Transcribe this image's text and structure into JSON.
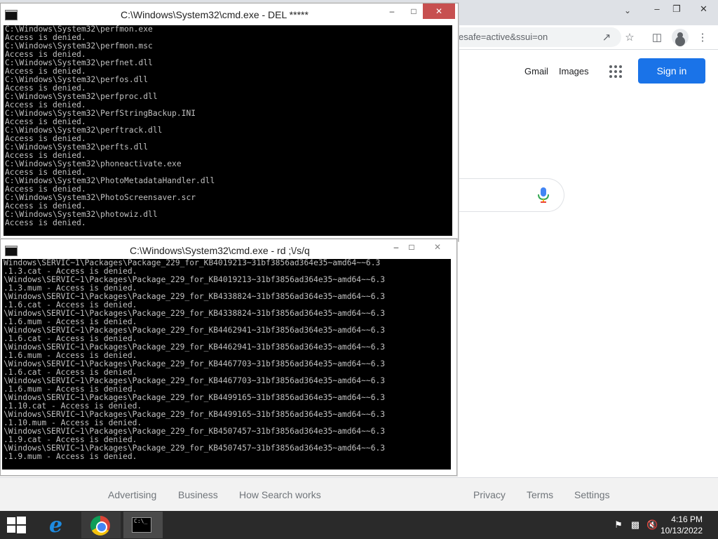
{
  "browser": {
    "omnibox_text": "esafe=active&ssui=on",
    "nav": {
      "gmail": "Gmail",
      "images": "Images"
    },
    "signin_label": "Sign in",
    "footer": {
      "advertising": "Advertising",
      "business": "Business",
      "how_search_works": "How Search works",
      "privacy": "Privacy",
      "terms": "Terms",
      "settings": "Settings"
    },
    "colors": {
      "signin_bg": "#1a73e8",
      "footer_bg": "#f2f2f2"
    }
  },
  "cmd_windows": [
    {
      "title": "C:\\Windows\\System32\\cmd.exe - DEL  *****",
      "lines": [
        "C:\\Windows\\System32\\perfmon.exe",
        "Access is denied.",
        "C:\\Windows\\System32\\perfmon.msc",
        "Access is denied.",
        "C:\\Windows\\System32\\perfnet.dll",
        "Access is denied.",
        "C:\\Windows\\System32\\perfos.dll",
        "Access is denied.",
        "C:\\Windows\\System32\\perfproc.dll",
        "Access is denied.",
        "C:\\Windows\\System32\\PerfStringBackup.INI",
        "Access is denied.",
        "C:\\Windows\\System32\\perftrack.dll",
        "Access is denied.",
        "C:\\Windows\\System32\\perfts.dll",
        "Access is denied.",
        "C:\\Windows\\System32\\phoneactivate.exe",
        "Access is denied.",
        "C:\\Windows\\System32\\PhotoMetadataHandler.dll",
        "Access is denied.",
        "C:\\Windows\\System32\\PhotoScreensaver.scr",
        "Access is denied.",
        "C:\\Windows\\System32\\photowiz.dll",
        "Access is denied."
      ]
    },
    {
      "title": "C:\\Windows\\System32\\cmd.exe - rd ;\\/s/q",
      "lines": [
        "Windows\\SERVIC~1\\Packages\\Package_229_for_KB4019213~31bf3856ad364e35~amd64~~6.3",
        ".1.3.cat - Access is denied.",
        "\\Windows\\SERVIC~1\\Packages\\Package_229_for_KB4019213~31bf3856ad364e35~amd64~~6.3",
        ".1.3.mum - Access is denied.",
        "\\Windows\\SERVIC~1\\Packages\\Package_229_for_KB4338824~31bf3856ad364e35~amd64~~6.3",
        ".1.6.cat - Access is denied.",
        "\\Windows\\SERVIC~1\\Packages\\Package_229_for_KB4338824~31bf3856ad364e35~amd64~~6.3",
        ".1.6.mum - Access is denied.",
        "\\Windows\\SERVIC~1\\Packages\\Package_229_for_KB4462941~31bf3856ad364e35~amd64~~6.3",
        ".1.6.cat - Access is denied.",
        "\\Windows\\SERVIC~1\\Packages\\Package_229_for_KB4462941~31bf3856ad364e35~amd64~~6.3",
        ".1.6.mum - Access is denied.",
        "\\Windows\\SERVIC~1\\Packages\\Package_229_for_KB4467703~31bf3856ad364e35~amd64~~6.3",
        ".1.6.cat - Access is denied.",
        "\\Windows\\SERVIC~1\\Packages\\Package_229_for_KB4467703~31bf3856ad364e35~amd64~~6.3",
        ".1.6.mum - Access is denied.",
        "\\Windows\\SERVIC~1\\Packages\\Package_229_for_KB4499165~31bf3856ad364e35~amd64~~6.3",
        ".1.10.cat - Access is denied.",
        "\\Windows\\SERVIC~1\\Packages\\Package_229_for_KB4499165~31bf3856ad364e35~amd64~~6.3",
        ".1.10.mum - Access is denied.",
        "\\Windows\\SERVIC~1\\Packages\\Package_229_for_KB4507457~31bf3856ad364e35~amd64~~6.3",
        ".1.9.cat - Access is denied.",
        "\\Windows\\SERVIC~1\\Packages\\Package_229_for_KB4507457~31bf3856ad364e35~amd64~~6.3",
        ".1.9.mum - Access is denied."
      ]
    }
  ],
  "taskbar": {
    "apps": [
      "internet-explorer",
      "chrome",
      "command-prompt"
    ],
    "active_app": "command-prompt",
    "clock_time": "4:16 PM",
    "clock_date": "10/13/2022",
    "bg_color": "#2a2a2a"
  }
}
